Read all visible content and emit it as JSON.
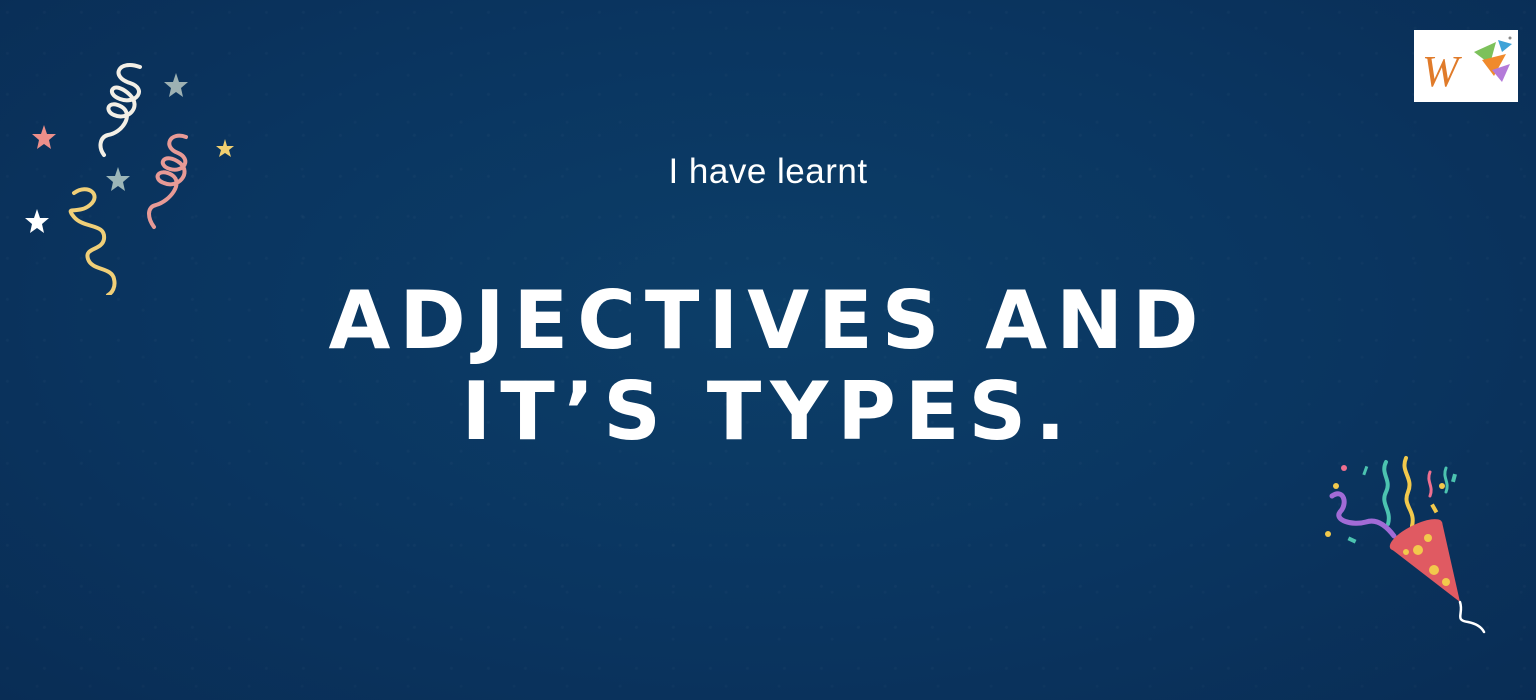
{
  "slide": {
    "subtitle": "I have learnt",
    "title_line1": "ADJECTIVES AND",
    "title_line2": "IT’S TYPES.",
    "logo_letter": "W"
  },
  "colors": {
    "background": "#0a3560",
    "text": "#ffffff",
    "logo_letter": "#e07b2a"
  },
  "icons": {
    "top_left": "confetti-streamers-stars-icon",
    "bottom_right": "party-popper-icon",
    "top_right": "brand-logo"
  }
}
